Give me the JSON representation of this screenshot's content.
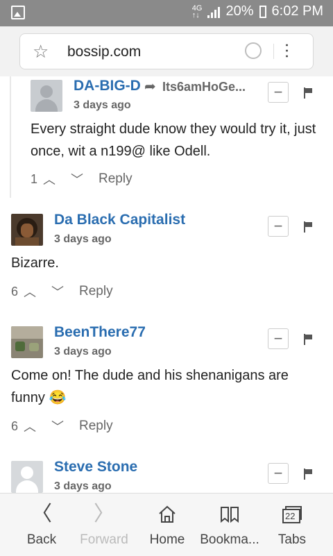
{
  "status": {
    "battery": "20%",
    "time": "6:02 PM"
  },
  "urlbar": {
    "url": "bossip.com"
  },
  "comments": [
    {
      "author": "DA-BIG-D",
      "reply_to": "Its6amHoGe...",
      "time": "3 days ago",
      "body": "Every straight dude know they would try it, just once, wit a n199@ like Odell.",
      "votes": "1",
      "reply_label": "Reply"
    },
    {
      "author": "Da Black Capitalist",
      "time": "3 days ago",
      "body": "Bizarre.",
      "votes": "6",
      "reply_label": "Reply"
    },
    {
      "author": "BeenThere77",
      "time": "3 days ago",
      "body": "Come on! The dude and his shenanigans are funny 😂",
      "votes": "6",
      "reply_label": "Reply"
    },
    {
      "author": "Steve Stone",
      "time": "3 days ago"
    }
  ],
  "nav": {
    "back": "Back",
    "forward": "Forward",
    "home": "Home",
    "bookmarks": "Bookma...",
    "tabs": "Tabs",
    "tab_count": "22"
  },
  "colors": {
    "author": "#2a6db0",
    "statusbar": "#8a8a8a"
  }
}
